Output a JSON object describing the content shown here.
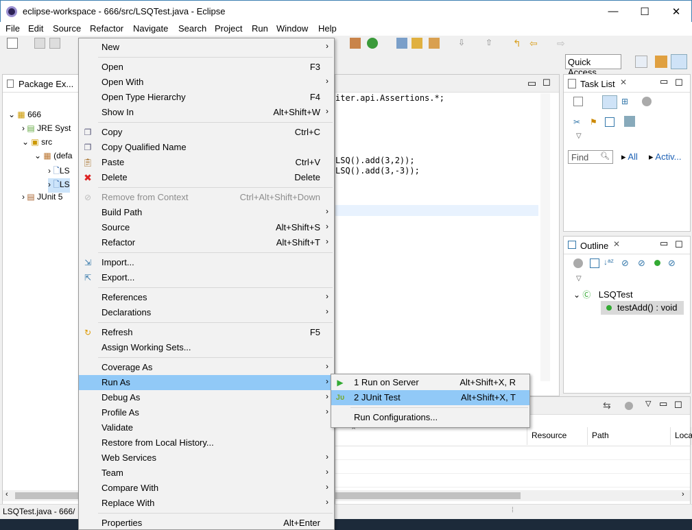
{
  "window": {
    "title": "eclipse-workspace - 666/src/LSQTest.java - Eclipse",
    "minimize": "—",
    "maximize": "☐",
    "close": "✕"
  },
  "menubar": [
    "File",
    "Edit",
    "Source",
    "Refactor",
    "Navigate",
    "Search",
    "Project",
    "Run",
    "Window",
    "Help"
  ],
  "quick_access": "Quick Access",
  "package_explorer": {
    "title": "Package Ex...",
    "tree": [
      {
        "label": "666"
      },
      {
        "label": "JRE Syst"
      },
      {
        "label": "src"
      },
      {
        "label": "(defa"
      },
      {
        "label": "LS"
      },
      {
        "label": "LS"
      },
      {
        "label": "JUnit 5"
      }
    ]
  },
  "editor": {
    "lines": [
      "iter.api.Assertions.*;",
      "LSQ().add(3,2));",
      "LSQ().add(3,-3));"
    ]
  },
  "task_list": {
    "title": "Task List",
    "find_placeholder": "Find",
    "all": "All",
    "activate": "Activ..."
  },
  "outline": {
    "title": "Outline",
    "class_name": "LSQTest",
    "method": "testAdd() : void"
  },
  "bottom_table": {
    "headers": [
      "Resource",
      "Path",
      "Loca"
    ]
  },
  "status_bar": {
    "text": "LSQTest.java - 666/"
  },
  "context_menu": {
    "items": [
      {
        "label": "New",
        "shortcut": "",
        "submenu": true
      },
      {
        "label": "Open",
        "shortcut": "F3",
        "submenu": false
      },
      {
        "label": "Open With",
        "shortcut": "",
        "submenu": true
      },
      {
        "label": "Open Type Hierarchy",
        "shortcut": "F4",
        "submenu": false
      },
      {
        "label": "Show In",
        "shortcut": "Alt+Shift+W",
        "submenu": true
      },
      {
        "label": "Copy",
        "shortcut": "Ctrl+C",
        "submenu": false
      },
      {
        "label": "Copy Qualified Name",
        "shortcut": "",
        "submenu": false
      },
      {
        "label": "Paste",
        "shortcut": "Ctrl+V",
        "submenu": false
      },
      {
        "label": "Delete",
        "shortcut": "Delete",
        "submenu": false
      },
      {
        "label": "Remove from Context",
        "shortcut": "Ctrl+Alt+Shift+Down",
        "submenu": false,
        "disabled": true
      },
      {
        "label": "Build Path",
        "shortcut": "",
        "submenu": true
      },
      {
        "label": "Source",
        "shortcut": "Alt+Shift+S",
        "submenu": true
      },
      {
        "label": "Refactor",
        "shortcut": "Alt+Shift+T",
        "submenu": true
      },
      {
        "label": "Import...",
        "shortcut": "",
        "submenu": false
      },
      {
        "label": "Export...",
        "shortcut": "",
        "submenu": false
      },
      {
        "label": "References",
        "shortcut": "",
        "submenu": true
      },
      {
        "label": "Declarations",
        "shortcut": "",
        "submenu": true
      },
      {
        "label": "Refresh",
        "shortcut": "F5",
        "submenu": false
      },
      {
        "label": "Assign Working Sets...",
        "shortcut": "",
        "submenu": false
      },
      {
        "label": "Coverage As",
        "shortcut": "",
        "submenu": true
      },
      {
        "label": "Run As",
        "shortcut": "",
        "submenu": true,
        "highlighted": true
      },
      {
        "label": "Debug As",
        "shortcut": "",
        "submenu": true
      },
      {
        "label": "Profile As",
        "shortcut": "",
        "submenu": true
      },
      {
        "label": "Validate",
        "shortcut": "",
        "submenu": false
      },
      {
        "label": "Restore from Local History...",
        "shortcut": "",
        "submenu": false
      },
      {
        "label": "Web Services",
        "shortcut": "",
        "submenu": true
      },
      {
        "label": "Team",
        "shortcut": "",
        "submenu": true
      },
      {
        "label": "Compare With",
        "shortcut": "",
        "submenu": true
      },
      {
        "label": "Replace With",
        "shortcut": "",
        "submenu": true
      },
      {
        "label": "Properties",
        "shortcut": "Alt+Enter",
        "submenu": false
      }
    ]
  },
  "run_as_submenu": {
    "items": [
      {
        "label": "1 Run on Server",
        "shortcut": "Alt+Shift+X, R"
      },
      {
        "label": "2 JUnit Test",
        "shortcut": "Alt+Shift+X, T",
        "highlighted": true
      },
      {
        "label": "Run Configurations...",
        "shortcut": ""
      }
    ]
  }
}
